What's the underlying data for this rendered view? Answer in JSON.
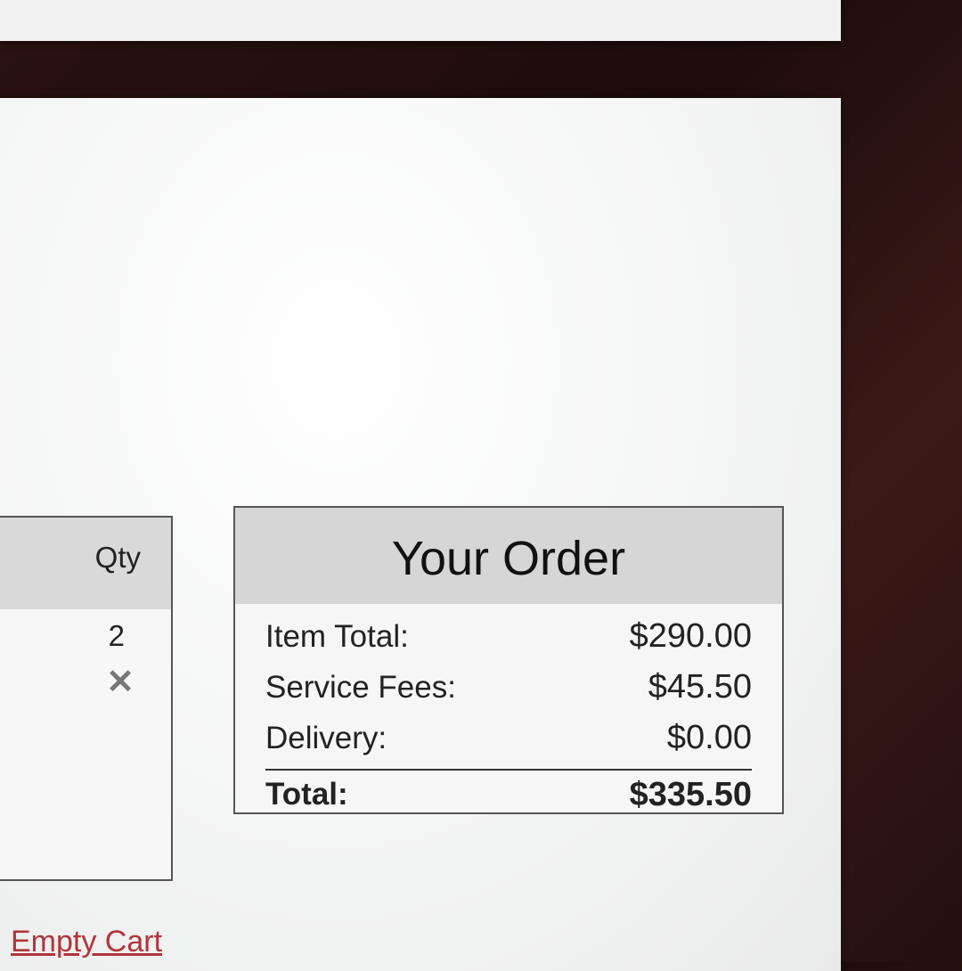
{
  "cart": {
    "qty_header": "Qty",
    "items": [
      {
        "qty": "2"
      }
    ],
    "remove_icon": "close-icon",
    "empty_cart_label": "Empty Cart"
  },
  "order": {
    "title": "Your Order",
    "item_total_label": "Item Total:",
    "item_total_value": "$290.00",
    "service_fees_label": "Service Fees:",
    "service_fees_value": "$45.50",
    "delivery_label": "Delivery:",
    "delivery_value": "$0.00",
    "total_label": "Total:",
    "total_value": "$335.50"
  },
  "colors": {
    "link": "#b0353c",
    "header_bg": "#d6d6d6"
  }
}
